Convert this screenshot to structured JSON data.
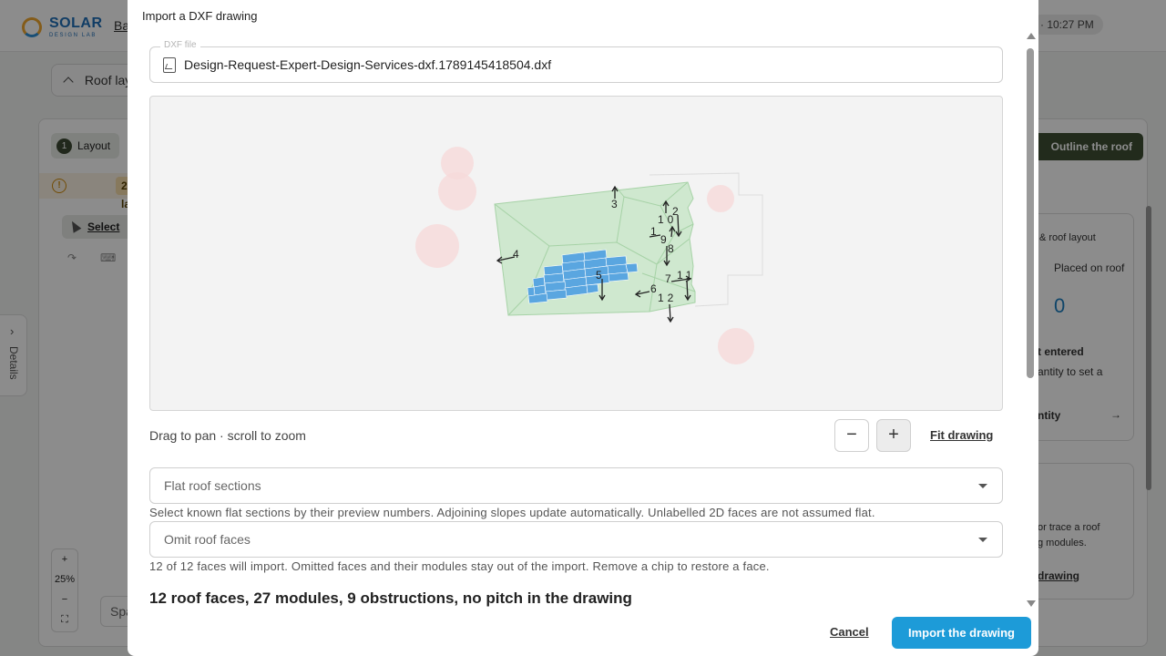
{
  "app": {
    "logo_main": "SOLAR",
    "logo_sub": "DESIGN LAB",
    "breadcrumb": "Ba",
    "clock": "· 10:27 PM",
    "roof_tab": "Roof lay",
    "layout_step_num": "1",
    "layout_step": "Layout",
    "warning_badge": "2 layout",
    "warning_icon": "!",
    "select_tool": "Select",
    "details_tab": "Details",
    "details_chevron": "›",
    "zoom_in": "+",
    "zoom_level": "25%",
    "zoom_out": "−",
    "spa": "Spa",
    "outline_button": "Outline the roof",
    "right_panel": {
      "heading": "& roof layout",
      "placed_label": "Placed on roof",
      "placed_value": "0",
      "not_entered": "t entered",
      "quantity_hint": "antity to set a",
      "quantity_link": "ntity",
      "trace_hint": "or trace a roof",
      "modules_hint": "g modules.",
      "drawing_link": "drawing"
    }
  },
  "modal": {
    "title": "Import a DXF drawing",
    "file_label": "DXF file",
    "file_name": "Design-Request-Expert-Design-Services-dxf.1789145418504.dxf",
    "hint": "Drag to pan · scroll to zoom",
    "zoom_out_label": "−",
    "zoom_in_label": "+",
    "fit_drawing": "Fit drawing",
    "flat_sections_placeholder": "Flat roof sections",
    "flat_sections_help": "Select known flat sections by their preview numbers. Adjoining slopes update automatically. Unlabelled 2D faces are not assumed flat.",
    "omit_faces_placeholder": "Omit roof faces",
    "omit_faces_help": "12 of 12 faces will import. Omitted faces and their modules stay out of the import. Remove a chip to restore a face.",
    "summary": "12 roof faces, 27 modules, 9 obstructions, no pitch in the drawing",
    "cancel": "Cancel",
    "import": "Import the drawing",
    "face_labels": [
      "1",
      "2",
      "3",
      "4",
      "5",
      "6",
      "7",
      "8",
      "9",
      "10",
      "11",
      "12"
    ]
  },
  "colors": {
    "primary": "#1d9bd8",
    "roof_face": "#cfe8cf",
    "module": "#5aa6e0",
    "obstruction": "#f5d7d7",
    "outline_button": "#3e4f34"
  }
}
